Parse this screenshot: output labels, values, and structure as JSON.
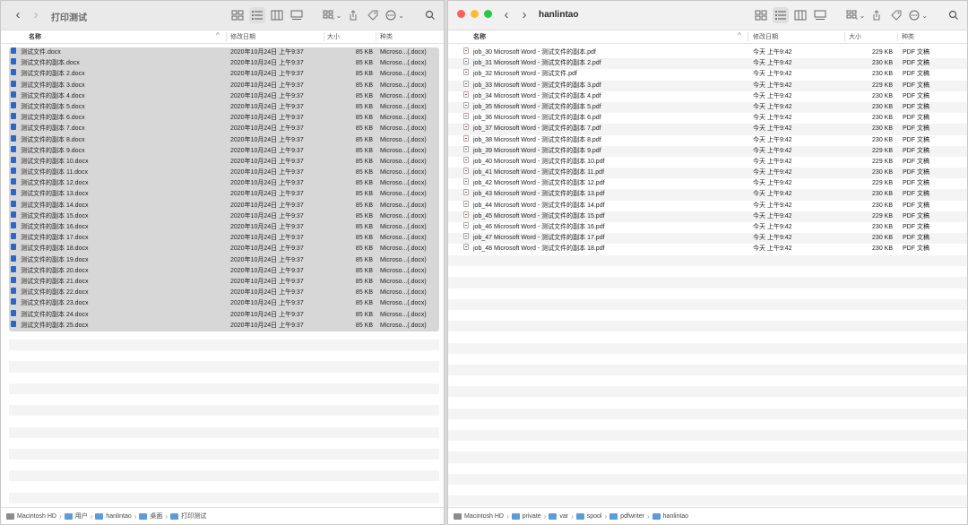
{
  "left": {
    "title": "打印测试",
    "columns": {
      "name": "名称",
      "date": "修改日期",
      "size": "大小",
      "kind": "种类"
    },
    "files": [
      {
        "name": "测试文件.docx"
      },
      {
        "name": "测试文件的副本.docx"
      },
      {
        "name": "测试文件的副本 2.docx"
      },
      {
        "name": "测试文件的副本 3.docx"
      },
      {
        "name": "测试文件的副本 4.docx"
      },
      {
        "name": "测试文件的副本 5.docx"
      },
      {
        "name": "测试文件的副本 6.docx"
      },
      {
        "name": "测试文件的副本 7.docx"
      },
      {
        "name": "测试文件的副本 8.docx"
      },
      {
        "name": "测试文件的副本 9.docx"
      },
      {
        "name": "测试文件的副本 10.docx"
      },
      {
        "name": "测试文件的副本 11.docx"
      },
      {
        "name": "测试文件的副本 12.docx"
      },
      {
        "name": "测试文件的副本 13.docx"
      },
      {
        "name": "测试文件的副本 14.docx"
      },
      {
        "name": "测试文件的副本 15.docx"
      },
      {
        "name": "测试文件的副本 16.docx"
      },
      {
        "name": "测试文件的副本 17.docx"
      },
      {
        "name": "测试文件的副本 18.docx"
      },
      {
        "name": "测试文件的副本 19.docx"
      },
      {
        "name": "测试文件的副本 20.docx"
      },
      {
        "name": "测试文件的副本 21.docx"
      },
      {
        "name": "测试文件的副本 22.docx"
      },
      {
        "name": "测试文件的副本 23.docx"
      },
      {
        "name": "测试文件的副本 24.docx"
      },
      {
        "name": "测试文件的副本 25.docx"
      }
    ],
    "file_date": "2020年10月24日 上午9:37",
    "file_size": "85 KB",
    "file_kind": "Microso...(.docx)",
    "path": [
      "Macintosh HD",
      "用户",
      "hanlintao",
      "桌面",
      "打印测试"
    ]
  },
  "right": {
    "title": "hanlintao",
    "columns": {
      "name": "名称",
      "date": "修改日期",
      "size": "大小",
      "kind": "种类"
    },
    "files": [
      {
        "name": "job_30 Microsoft Word - 测试文件的副本.pdf",
        "size": "229 KB"
      },
      {
        "name": "job_31 Microsoft Word - 测试文件的副本 2.pdf",
        "size": "230 KB"
      },
      {
        "name": "job_32 Microsoft Word - 测试文件.pdf",
        "size": "230 KB"
      },
      {
        "name": "job_33 Microsoft Word - 测试文件的副本 3.pdf",
        "size": "229 KB"
      },
      {
        "name": "job_34 Microsoft Word - 测试文件的副本 4.pdf",
        "size": "230 KB"
      },
      {
        "name": "job_35 Microsoft Word - 测试文件的副本 5.pdf",
        "size": "230 KB"
      },
      {
        "name": "job_36 Microsoft Word - 测试文件的副本 6.pdf",
        "size": "230 KB"
      },
      {
        "name": "job_37 Microsoft Word - 测试文件的副本 7.pdf",
        "size": "230 KB"
      },
      {
        "name": "job_38 Microsoft Word - 测试文件的副本 8.pdf",
        "size": "230 KB"
      },
      {
        "name": "job_39 Microsoft Word - 测试文件的副本 9.pdf",
        "size": "229 KB"
      },
      {
        "name": "job_40 Microsoft Word - 测试文件的副本 10.pdf",
        "size": "229 KB"
      },
      {
        "name": "job_41 Microsoft Word - 测试文件的副本 11.pdf",
        "size": "230 KB"
      },
      {
        "name": "job_42 Microsoft Word - 测试文件的副本 12.pdf",
        "size": "229 KB"
      },
      {
        "name": "job_43 Microsoft Word - 测试文件的副本 13.pdf",
        "size": "230 KB"
      },
      {
        "name": "job_44 Microsoft Word - 测试文件的副本 14.pdf",
        "size": "230 KB"
      },
      {
        "name": "job_45 Microsoft Word - 测试文件的副本 15.pdf",
        "size": "229 KB"
      },
      {
        "name": "job_46 Microsoft Word - 测试文件的副本 16.pdf",
        "size": "230 KB"
      },
      {
        "name": "job_47 Microsoft Word - 测试文件的副本 17.pdf",
        "size": "230 KB"
      },
      {
        "name": "job_48 Microsoft Word - 测试文件的副本 18.pdf",
        "size": "230 KB"
      }
    ],
    "file_date": "今天 上午9:42",
    "file_kind": "PDF 文稿",
    "path": [
      "Macintosh HD",
      "private",
      "var",
      "spool",
      "pdfwriter",
      "hanlintao"
    ]
  },
  "icons": {
    "back": "chevron-left-icon",
    "forward": "chevron-right-icon",
    "views": [
      "icon-view-icon",
      "list-view-icon",
      "column-view-icon",
      "gallery-view-icon"
    ],
    "group": "group-icon",
    "share": "share-icon",
    "tag": "tag-icon",
    "action": "more-icon",
    "search": "search-icon"
  },
  "colors": {
    "close": "#fe5f57",
    "minimize": "#febc2e",
    "zoom": "#28c840",
    "selection": "#d7d7d7",
    "doc_icon": "#2b66c9"
  }
}
